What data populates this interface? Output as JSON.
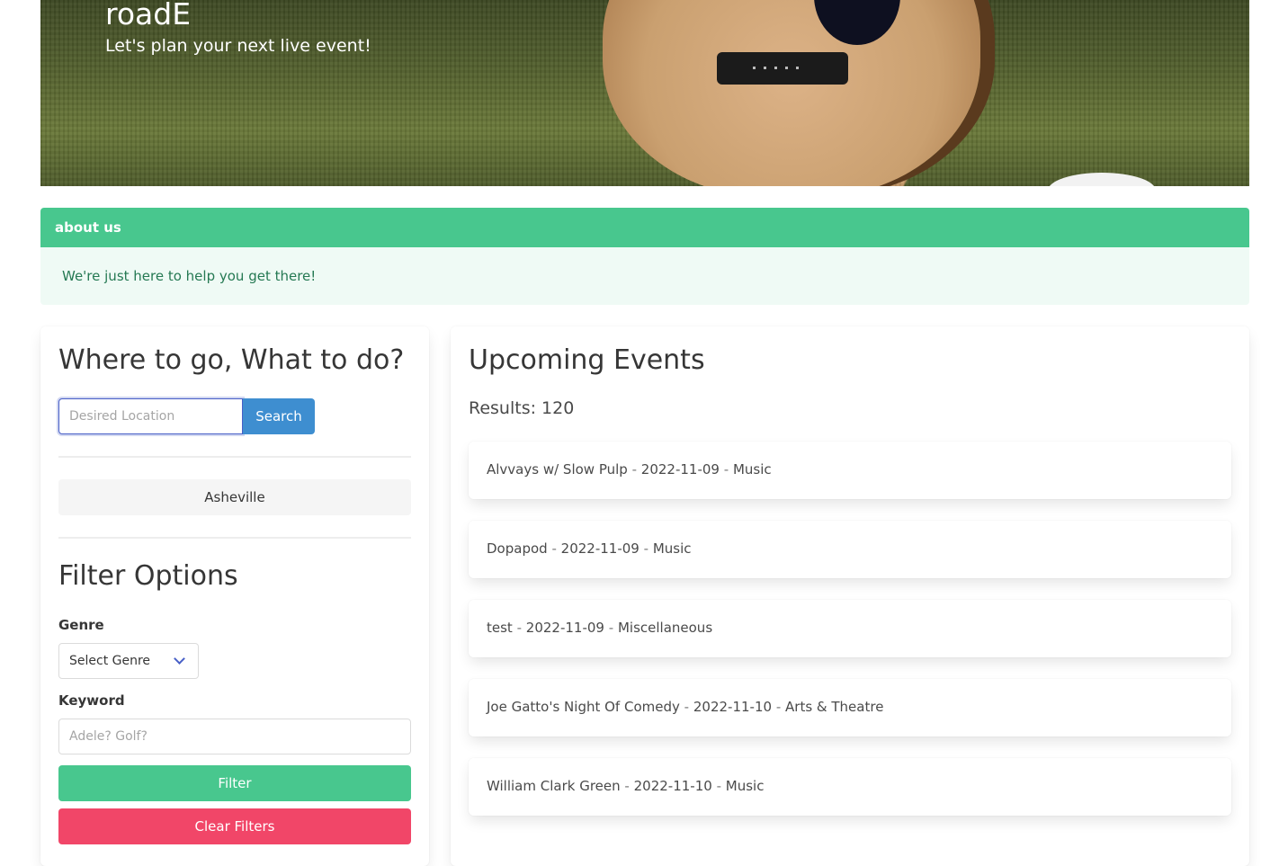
{
  "hero": {
    "title": "roadE",
    "subtitle": "Let's plan your next live event!"
  },
  "about": {
    "header": "about us",
    "body": "We're just here to help you get there!"
  },
  "search_panel": {
    "title": "Where to go, What to do?",
    "location_placeholder": "Desired Location",
    "search_label": "Search",
    "city": "Asheville"
  },
  "filters": {
    "title": "Filter Options",
    "genre_label": "Genre",
    "genre_value": "Select Genre",
    "keyword_label": "Keyword",
    "keyword_placeholder": "Adele? Golf?",
    "filter_label": "Filter",
    "clear_label": "Clear Filters"
  },
  "events": {
    "title": "Upcoming Events",
    "results_label": "Results:",
    "results_count": "120",
    "separator": "-",
    "items": [
      {
        "name": "Alvvays w/ Slow Pulp",
        "date": "2022-11-09",
        "category": "Music"
      },
      {
        "name": "Dopapod",
        "date": "2022-11-09",
        "category": "Music"
      },
      {
        "name": "test",
        "date": "2022-11-09",
        "category": "Miscellaneous"
      },
      {
        "name": "Joe Gatto's Night Of Comedy",
        "date": "2022-11-10",
        "category": "Arts & Theatre"
      },
      {
        "name": "William Clark Green",
        "date": "2022-11-10",
        "category": "Music"
      }
    ]
  },
  "colors": {
    "primary_green": "#48c78e",
    "danger": "#f14668",
    "info": "#3e8ed0",
    "link": "#485fc7"
  }
}
